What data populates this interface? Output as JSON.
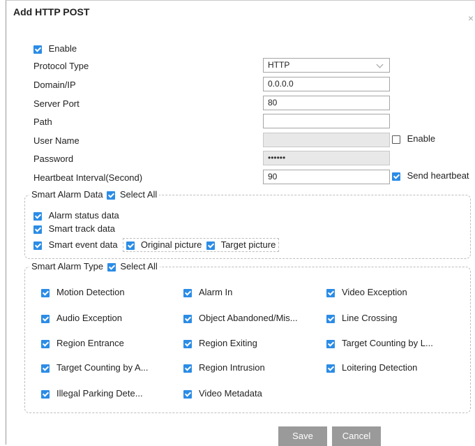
{
  "dialog": {
    "title": "Add HTTP POST",
    "close": "×"
  },
  "form": {
    "enable_label": "Enable",
    "protocol_type_label": "Protocol Type",
    "protocol_type_value": "HTTP",
    "domain_label": "Domain/IP",
    "domain_value": "0.0.0.0",
    "port_label": "Server Port",
    "port_value": "80",
    "path_label": "Path",
    "path_value": "",
    "username_label": "User Name",
    "username_value": "",
    "auth_enable_label": "Enable",
    "password_label": "Password",
    "password_value": "••••••",
    "heartbeat_label": "Heartbeat Interval(Second)",
    "heartbeat_value": "90",
    "send_heartbeat_label": "Send heartbeat"
  },
  "smart_alarm_data": {
    "title": "Smart Alarm Data",
    "select_all": "Select All",
    "alarm_status": "Alarm status data",
    "smart_track": "Smart track data",
    "smart_event": "Smart event data",
    "original_picture": "Original picture",
    "target_picture": "Target picture"
  },
  "smart_alarm_type": {
    "title": "Smart Alarm Type",
    "select_all": "Select All",
    "items": [
      "Motion Detection",
      "Alarm In",
      "Video Exception",
      "Audio Exception",
      "Object Abandoned/Mis...",
      "Line Crossing",
      "Region Entrance",
      "Region Exiting",
      "Target Counting by L...",
      "Target Counting by A...",
      "Region Intrusion",
      "Loitering Detection",
      "Illegal Parking Dete...",
      "Video Metadata"
    ]
  },
  "buttons": {
    "save": "Save",
    "cancel": "Cancel"
  },
  "colors": {
    "checkbox": "#2b8ce6",
    "button": "#9a9a9a",
    "disabled_field": "#e8e8e8"
  }
}
